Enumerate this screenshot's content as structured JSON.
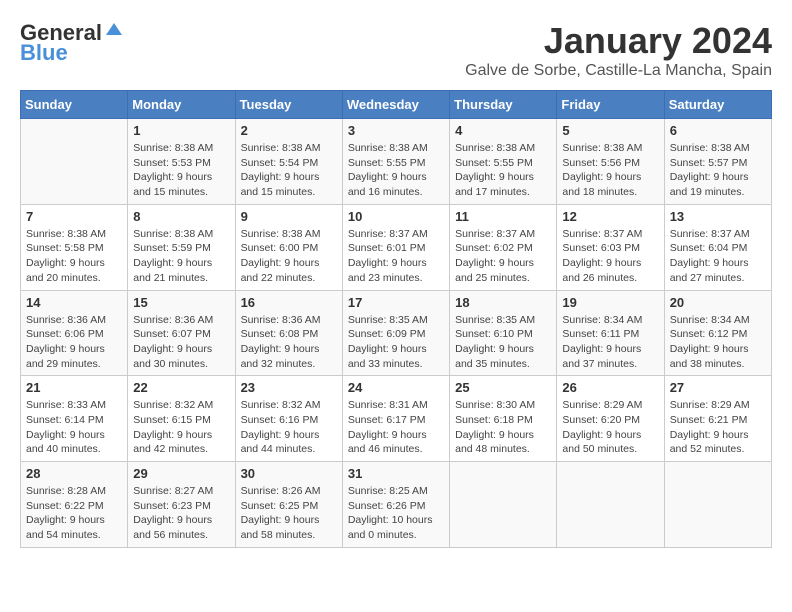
{
  "header": {
    "logo_general": "General",
    "logo_blue": "Blue",
    "month_title": "January 2024",
    "location": "Galve de Sorbe, Castille-La Mancha, Spain"
  },
  "weekdays": [
    "Sunday",
    "Monday",
    "Tuesday",
    "Wednesday",
    "Thursday",
    "Friday",
    "Saturday"
  ],
  "weeks": [
    [
      {
        "day": "",
        "info": ""
      },
      {
        "day": "1",
        "info": "Sunrise: 8:38 AM\nSunset: 5:53 PM\nDaylight: 9 hours\nand 15 minutes."
      },
      {
        "day": "2",
        "info": "Sunrise: 8:38 AM\nSunset: 5:54 PM\nDaylight: 9 hours\nand 15 minutes."
      },
      {
        "day": "3",
        "info": "Sunrise: 8:38 AM\nSunset: 5:55 PM\nDaylight: 9 hours\nand 16 minutes."
      },
      {
        "day": "4",
        "info": "Sunrise: 8:38 AM\nSunset: 5:55 PM\nDaylight: 9 hours\nand 17 minutes."
      },
      {
        "day": "5",
        "info": "Sunrise: 8:38 AM\nSunset: 5:56 PM\nDaylight: 9 hours\nand 18 minutes."
      },
      {
        "day": "6",
        "info": "Sunrise: 8:38 AM\nSunset: 5:57 PM\nDaylight: 9 hours\nand 19 minutes."
      }
    ],
    [
      {
        "day": "7",
        "info": "Sunrise: 8:38 AM\nSunset: 5:58 PM\nDaylight: 9 hours\nand 20 minutes."
      },
      {
        "day": "8",
        "info": "Sunrise: 8:38 AM\nSunset: 5:59 PM\nDaylight: 9 hours\nand 21 minutes."
      },
      {
        "day": "9",
        "info": "Sunrise: 8:38 AM\nSunset: 6:00 PM\nDaylight: 9 hours\nand 22 minutes."
      },
      {
        "day": "10",
        "info": "Sunrise: 8:37 AM\nSunset: 6:01 PM\nDaylight: 9 hours\nand 23 minutes."
      },
      {
        "day": "11",
        "info": "Sunrise: 8:37 AM\nSunset: 6:02 PM\nDaylight: 9 hours\nand 25 minutes."
      },
      {
        "day": "12",
        "info": "Sunrise: 8:37 AM\nSunset: 6:03 PM\nDaylight: 9 hours\nand 26 minutes."
      },
      {
        "day": "13",
        "info": "Sunrise: 8:37 AM\nSunset: 6:04 PM\nDaylight: 9 hours\nand 27 minutes."
      }
    ],
    [
      {
        "day": "14",
        "info": "Sunrise: 8:36 AM\nSunset: 6:06 PM\nDaylight: 9 hours\nand 29 minutes."
      },
      {
        "day": "15",
        "info": "Sunrise: 8:36 AM\nSunset: 6:07 PM\nDaylight: 9 hours\nand 30 minutes."
      },
      {
        "day": "16",
        "info": "Sunrise: 8:36 AM\nSunset: 6:08 PM\nDaylight: 9 hours\nand 32 minutes."
      },
      {
        "day": "17",
        "info": "Sunrise: 8:35 AM\nSunset: 6:09 PM\nDaylight: 9 hours\nand 33 minutes."
      },
      {
        "day": "18",
        "info": "Sunrise: 8:35 AM\nSunset: 6:10 PM\nDaylight: 9 hours\nand 35 minutes."
      },
      {
        "day": "19",
        "info": "Sunrise: 8:34 AM\nSunset: 6:11 PM\nDaylight: 9 hours\nand 37 minutes."
      },
      {
        "day": "20",
        "info": "Sunrise: 8:34 AM\nSunset: 6:12 PM\nDaylight: 9 hours\nand 38 minutes."
      }
    ],
    [
      {
        "day": "21",
        "info": "Sunrise: 8:33 AM\nSunset: 6:14 PM\nDaylight: 9 hours\nand 40 minutes."
      },
      {
        "day": "22",
        "info": "Sunrise: 8:32 AM\nSunset: 6:15 PM\nDaylight: 9 hours\nand 42 minutes."
      },
      {
        "day": "23",
        "info": "Sunrise: 8:32 AM\nSunset: 6:16 PM\nDaylight: 9 hours\nand 44 minutes."
      },
      {
        "day": "24",
        "info": "Sunrise: 8:31 AM\nSunset: 6:17 PM\nDaylight: 9 hours\nand 46 minutes."
      },
      {
        "day": "25",
        "info": "Sunrise: 8:30 AM\nSunset: 6:18 PM\nDaylight: 9 hours\nand 48 minutes."
      },
      {
        "day": "26",
        "info": "Sunrise: 8:29 AM\nSunset: 6:20 PM\nDaylight: 9 hours\nand 50 minutes."
      },
      {
        "day": "27",
        "info": "Sunrise: 8:29 AM\nSunset: 6:21 PM\nDaylight: 9 hours\nand 52 minutes."
      }
    ],
    [
      {
        "day": "28",
        "info": "Sunrise: 8:28 AM\nSunset: 6:22 PM\nDaylight: 9 hours\nand 54 minutes."
      },
      {
        "day": "29",
        "info": "Sunrise: 8:27 AM\nSunset: 6:23 PM\nDaylight: 9 hours\nand 56 minutes."
      },
      {
        "day": "30",
        "info": "Sunrise: 8:26 AM\nSunset: 6:25 PM\nDaylight: 9 hours\nand 58 minutes."
      },
      {
        "day": "31",
        "info": "Sunrise: 8:25 AM\nSunset: 6:26 PM\nDaylight: 10 hours\nand 0 minutes."
      },
      {
        "day": "",
        "info": ""
      },
      {
        "day": "",
        "info": ""
      },
      {
        "day": "",
        "info": ""
      }
    ]
  ]
}
